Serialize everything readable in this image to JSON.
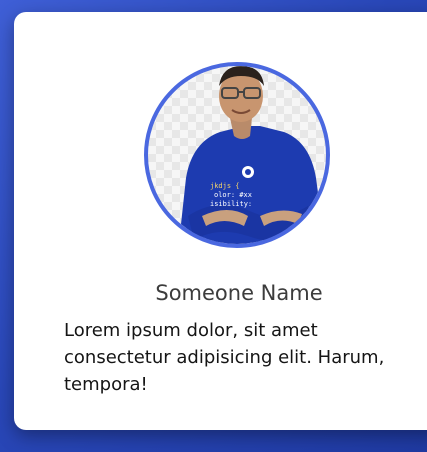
{
  "card": {
    "name": "Someone Name",
    "description": "Lorem ipsum dolor, sit amet consectetur adipisicing elit. Harum, tempora!"
  },
  "colors": {
    "background": "#2f4ec0",
    "card": "#ffffff",
    "avatar_ring": "#4a68e0",
    "shirt": "#1d3bb0",
    "name_text": "#3c3c3c",
    "body_text": "#151515"
  }
}
